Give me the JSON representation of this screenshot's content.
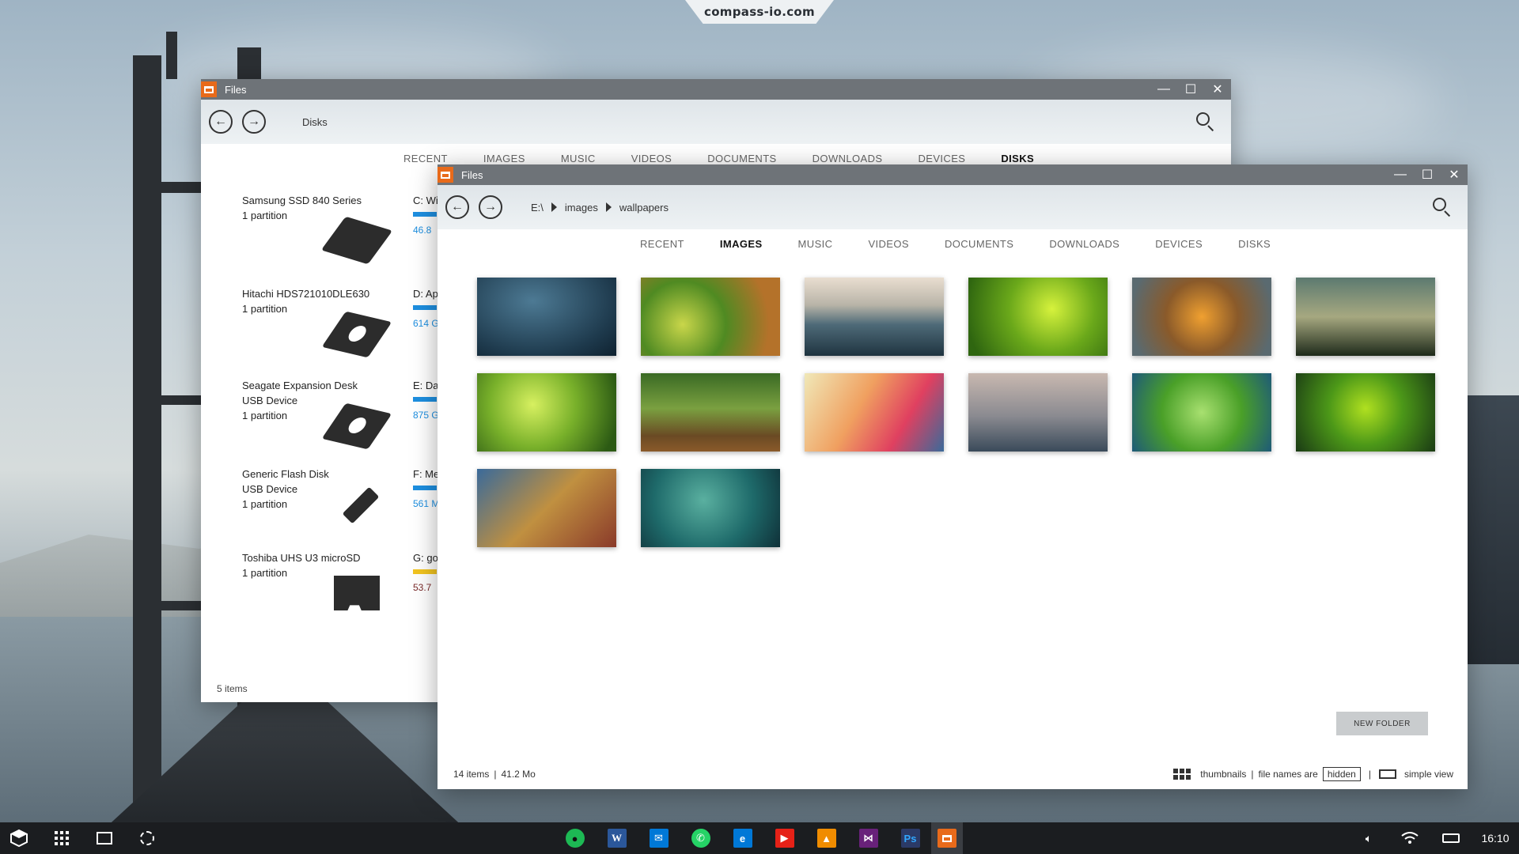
{
  "site": {
    "domain": "compass-io.com"
  },
  "colors": {
    "accent_orange": "#e86a1a",
    "accent_blue": "#1e8fe0",
    "warning_yellow": "#f2c420",
    "titlebar": "#6e7378",
    "taskbar": "#1b1d20"
  },
  "disks_window": {
    "title": "Files",
    "location": "Disks",
    "tabs": [
      "RECENT",
      "IMAGES",
      "MUSIC",
      "VIDEOS",
      "DOCUMENTS",
      "DOWNLOADS",
      "DEVICES",
      "DISKS"
    ],
    "active_tab": "DISKS",
    "disks": [
      {
        "name": "Samsung SSD 840 Series",
        "sub": "",
        "partitions": "1 partition",
        "icon": "ssd-icon",
        "volume": "C: Wi",
        "free": "46.8 "
      },
      {
        "name": "Hitachi HDS721010DLE630",
        "sub": "",
        "partitions": "1 partition",
        "icon": "hdd-icon",
        "volume": "D: Ap",
        "free": "614 G"
      },
      {
        "name": "Seagate Expansion Desk",
        "sub": "USB Device",
        "partitions": "1 partition",
        "icon": "hdd-icon",
        "volume": "E: Da",
        "free": "875 G"
      },
      {
        "name": "Generic Flash Disk",
        "sub": "USB Device",
        "partitions": "1 partition",
        "icon": "usb-stick-icon",
        "volume": "F: Me",
        "free": "561 M"
      },
      {
        "name": "Toshiba UHS U3 microSD",
        "sub": "",
        "partitions": "1 partition",
        "icon": "sd-card-icon",
        "volume": "G: go",
        "free": "53.7 "
      }
    ],
    "status": "5 items"
  },
  "images_window": {
    "title": "Files",
    "breadcrumb": [
      "E:\\",
      "images",
      "wallpapers"
    ],
    "tabs": [
      "RECENT",
      "IMAGES",
      "MUSIC",
      "VIDEOS",
      "DOCUMENTS",
      "DOWNLOADS",
      "DEVICES",
      "DISKS"
    ],
    "active_tab": "IMAGES",
    "new_folder_label": "NEW FOLDER",
    "status": {
      "count": "14 items",
      "size": "41.2 Mo",
      "view_mode": "thumbnails",
      "file_names_label": "file names are",
      "file_names_state": "hidden",
      "simple_view": "simple view"
    }
  },
  "taskbar": {
    "left_icons": [
      "start-icon",
      "apps-grid-icon",
      "task-view-icon",
      "settings-icon"
    ],
    "apps": [
      {
        "name": "spotify-icon",
        "color": "#1db954",
        "glyph": "●"
      },
      {
        "name": "word-icon",
        "color": "#2b579a",
        "glyph": "W"
      },
      {
        "name": "mail-icon",
        "color": "#0078d7",
        "glyph": "✉"
      },
      {
        "name": "whatsapp-icon",
        "color": "#25d366",
        "glyph": "✆"
      },
      {
        "name": "edge-icon",
        "color": "#0078d7",
        "glyph": "e"
      },
      {
        "name": "youtube-icon",
        "color": "#e62117",
        "glyph": "▶"
      },
      {
        "name": "vlc-icon",
        "color": "#f08c00",
        "glyph": "▲"
      },
      {
        "name": "visual-studio-icon",
        "color": "#68217a",
        "glyph": "⋈"
      },
      {
        "name": "photoshop-icon",
        "color": "#2b3a67",
        "glyph": "Ps"
      },
      {
        "name": "files-app-icon",
        "color": "#e86a1a",
        "glyph": "▭"
      }
    ],
    "clock": "16:10"
  }
}
